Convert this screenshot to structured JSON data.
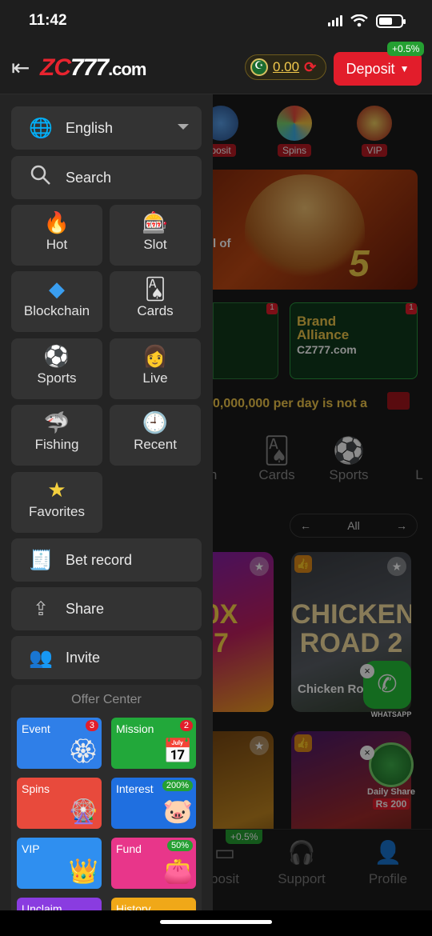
{
  "status": {
    "time": "11:42"
  },
  "header": {
    "logo_zc": "ZC",
    "logo_777": "777",
    "logo_com": ".com",
    "balance": "0.00",
    "deposit_label": "Deposit",
    "deposit_bonus": "+0.5%"
  },
  "menu": {
    "language": "English",
    "search": "Search",
    "categories": [
      {
        "label": "Hot",
        "icon": "flame-icon"
      },
      {
        "label": "Slot",
        "icon": "slot-machine-icon"
      },
      {
        "label": "Blockchain",
        "icon": "blockchain-cubes-icon"
      },
      {
        "label": "Cards",
        "icon": "playing-cards-icon"
      },
      {
        "label": "Sports",
        "icon": "soccer-ball-icon"
      },
      {
        "label": "Live",
        "icon": "live-dealer-icon"
      },
      {
        "label": "Fishing",
        "icon": "fish-icon"
      },
      {
        "label": "Recent",
        "icon": "clock-icon"
      },
      {
        "label": "Favorites",
        "icon": "star-icon"
      }
    ],
    "bet_record": "Bet record",
    "share": "Share",
    "invite": "Invite",
    "offer_center": {
      "title": "Offer Center",
      "cards": [
        {
          "label": "Event",
          "badge": "3",
          "color": "#2f7fe8"
        },
        {
          "label": "Mission",
          "badge": "2",
          "color": "#22a83a"
        },
        {
          "label": "Spins",
          "badge": "",
          "color": "#e84a3c"
        },
        {
          "label": "Interest",
          "badge": "200%",
          "color": "#1f6fe0"
        },
        {
          "label": "VIP",
          "badge": "",
          "color": "#2f8ff0"
        },
        {
          "label": "Fund",
          "badge": "50%",
          "color": "#e8368a"
        },
        {
          "label": "Unclaim",
          "badge": "",
          "color": "#8a3ce0"
        },
        {
          "label": "History",
          "badge": "",
          "color": "#f0a818"
        }
      ]
    }
  },
  "background": {
    "top_icons": [
      "posit",
      "Spins",
      "VIP"
    ],
    "banner_text": "l of",
    "banner_number": "5",
    "promo": {
      "line1": "Brand",
      "line2": "Alliance",
      "line3": "CZ777.com",
      "badge": "1"
    },
    "marquee": "0,000,000  per day is not a",
    "tabs": [
      "ain",
      "Cards",
      "Sports",
      "L"
    ],
    "filter_label": "All",
    "games": [
      {
        "title": "y777",
        "big": "00X\n77"
      },
      {
        "title": "Chicken Ro",
        "big": "CHICKEN\nROAD 2"
      },
      {
        "title": "",
        "big": ""
      },
      {
        "title": "",
        "big": ""
      }
    ],
    "whatsapp_label": "WHATSAPP",
    "daily_share": {
      "line1": "Daily Share",
      "line2": "Rs 200"
    },
    "nav": {
      "bonus": "+0.5%",
      "items": [
        "posit",
        "Support",
        "Profile"
      ]
    }
  }
}
